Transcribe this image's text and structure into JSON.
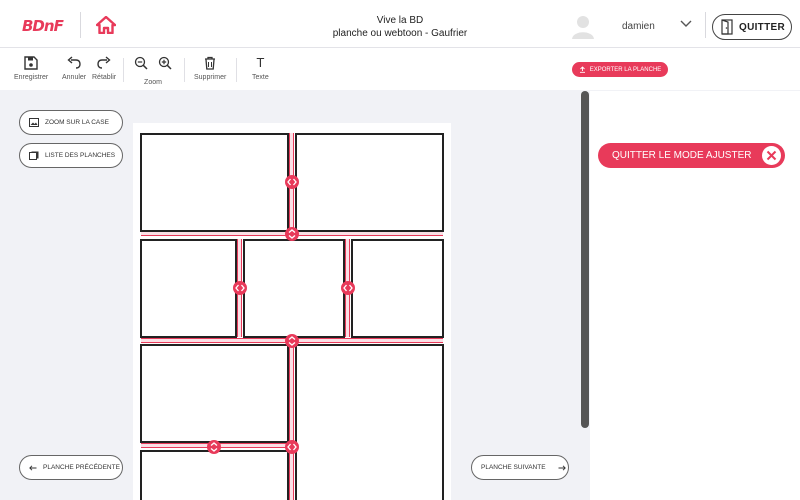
{
  "header": {
    "logo": "BDnF",
    "title_line1": "Vive la BD",
    "title_line2": "planche ou webtoon - Gaufrier",
    "username": "damien",
    "quit_label": "QUITTER"
  },
  "toolbar": {
    "save_label": "Enregistrer",
    "undo_label": "Annuler",
    "redo_label": "Rétablir",
    "zoom_label": "Zoom",
    "delete_label": "Supprimer",
    "text_label": "Texte",
    "text_icon_glyph": "T",
    "export_label": "EXPORTER LA PLANCHE"
  },
  "sidebar": {
    "zoom_case_label": "ZOOM SUR LA CASE",
    "boards_list_label": "LISTE DES PLANCHES",
    "prev_label": "PLANCHE PRÉCÉDENTE",
    "next_label": "PLANCHE SUIVANTE"
  },
  "adjust": {
    "label": "QUITTER LE MODE AJUSTER"
  },
  "colors": {
    "accent": "#e83a5a",
    "background": "#f1f2f6",
    "panel_border": "#222222"
  },
  "icons": [
    "home-icon",
    "avatar",
    "chevron-down-icon",
    "door-exit-icon",
    "save-icon",
    "undo-icon",
    "redo-icon",
    "zoom-out-icon",
    "zoom-in-icon",
    "trash-icon",
    "text-icon",
    "upload-icon",
    "image-icon",
    "pages-icon",
    "arrow-left-icon",
    "arrow-right-icon",
    "close-icon"
  ]
}
